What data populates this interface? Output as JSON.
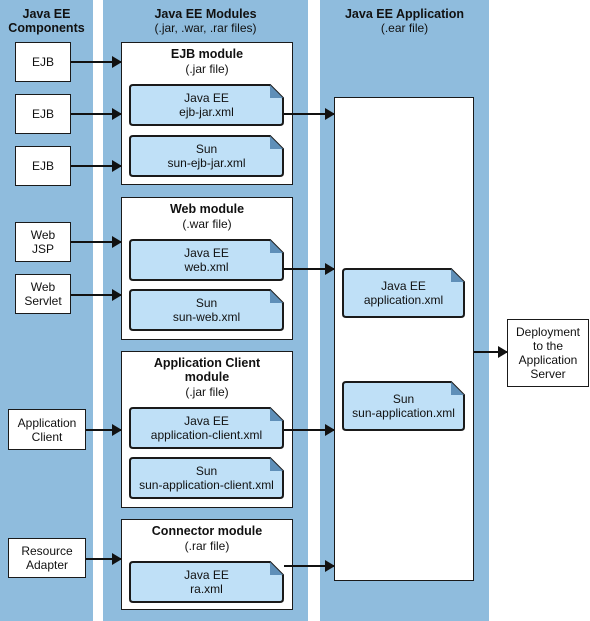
{
  "columns": {
    "components": {
      "title_line1": "Java EE",
      "title_line2": "Components"
    },
    "modules": {
      "title": "Java EE Modules",
      "subtitle": "(.jar, .war, .rar files)"
    },
    "application": {
      "title": "Java EE Application",
      "subtitle": "(.ear file)"
    }
  },
  "components": [
    {
      "line1": "EJB",
      "line2": ""
    },
    {
      "line1": "EJB",
      "line2": ""
    },
    {
      "line1": "EJB",
      "line2": ""
    },
    {
      "line1": "Web",
      "line2": "JSP"
    },
    {
      "line1": "Web",
      "line2": "Servlet"
    },
    {
      "line1": "Application",
      "line2": "Client"
    },
    {
      "line1": "Resource",
      "line2": "Adapter"
    }
  ],
  "modules": [
    {
      "title": "EJB module",
      "title2": "",
      "subtitle": "(.jar file)",
      "docs": [
        {
          "line1": "Java EE",
          "line2": "ejb-jar.xml"
        },
        {
          "line1": "Sun",
          "line2": "sun-ejb-jar.xml"
        }
      ]
    },
    {
      "title": "Web module",
      "title2": "",
      "subtitle": "(.war file)",
      "docs": [
        {
          "line1": "Java EE",
          "line2": "web.xml"
        },
        {
          "line1": "Sun",
          "line2": "sun-web.xml"
        }
      ]
    },
    {
      "title": "Application Client",
      "title2": "module",
      "subtitle": "(.jar file)",
      "docs": [
        {
          "line1": "Java EE",
          "line2": "application-client.xml"
        },
        {
          "line1": "Sun",
          "line2": "sun-application-client.xml"
        }
      ]
    },
    {
      "title": "Connector module",
      "title2": "",
      "subtitle": "(.rar file)",
      "docs": [
        {
          "line1": "Java EE",
          "line2": "ra.xml"
        }
      ]
    }
  ],
  "application": {
    "docs": [
      {
        "line1": "Java EE",
        "line2": "application.xml"
      },
      {
        "line1": "Sun",
        "line2": "sun-application.xml"
      }
    ]
  },
  "deployment": {
    "line1": "Deployment",
    "line2": "to the",
    "line3": "Application",
    "line4": "Server"
  },
  "colors": {
    "column_bg": "#8fbcdd",
    "doc_fill": "#bfe0f7",
    "doc_corner": "#5f8fb8",
    "stroke": "#1a1a1a"
  }
}
